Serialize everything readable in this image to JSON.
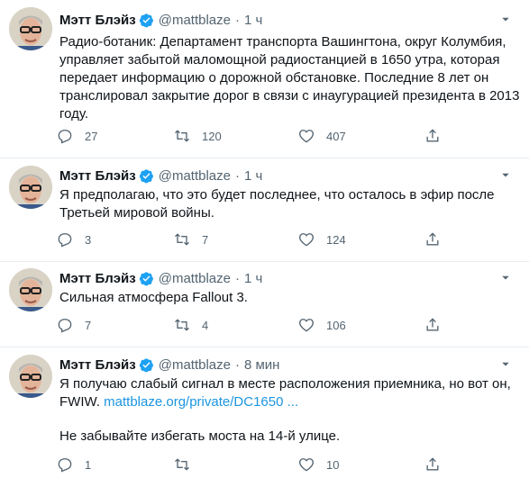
{
  "colors": {
    "accent": "#1da1f2",
    "link": "#1b95e0",
    "secondary_text": "#536471",
    "divider": "#e6ecf0"
  },
  "icons": {
    "reply": "reply-icon",
    "retweet": "retweet-icon",
    "like": "heart-icon",
    "share": "share-icon",
    "verified": "verified-badge-icon",
    "more": "more-options-icon"
  },
  "tweets": [
    {
      "author": "Мэтт Блэйз",
      "handle": "@mattblaze",
      "separator": "·",
      "time": "1 ч",
      "text": "Радио-ботаник: Департамент транспорта Вашингтона, округ Колумбия, управляет забытой маломощной радиостанцией в 1650 утра, которая передает информацию о дорожной обстановке. Последние 8 лет он транслировал закрытие дорог в связи с инаугурацией президента в 2013 году.",
      "replies": "27",
      "retweets": "120",
      "likes": "407"
    },
    {
      "author": "Мэтт Блэйз",
      "handle": "@mattblaze",
      "separator": "·",
      "time": "1 ч",
      "text": "Я предполагаю, что это будет последнее, что осталось в эфир после Третьей мировой войны.",
      "replies": "3",
      "retweets": "7",
      "likes": "124"
    },
    {
      "author": "Мэтт Блэйз",
      "handle": "@mattblaze",
      "separator": "·",
      "time": "1 ч",
      "text": "Сильная атмосфера Fallout 3.",
      "replies": "7",
      "retweets": "4",
      "likes": "106"
    },
    {
      "author": "Мэтт Блэйз",
      "handle": "@mattblaze",
      "separator": "·",
      "time": "8 мин",
      "text": "Я получаю слабый сигнал в месте расположения приемника, но вот он, FWIW.",
      "link": "mattblaze.org/private/DC1650 ...",
      "text2": "Не забывайте избегать моста на 14-й улице.",
      "replies": "1",
      "retweets": "",
      "likes": "10"
    }
  ]
}
